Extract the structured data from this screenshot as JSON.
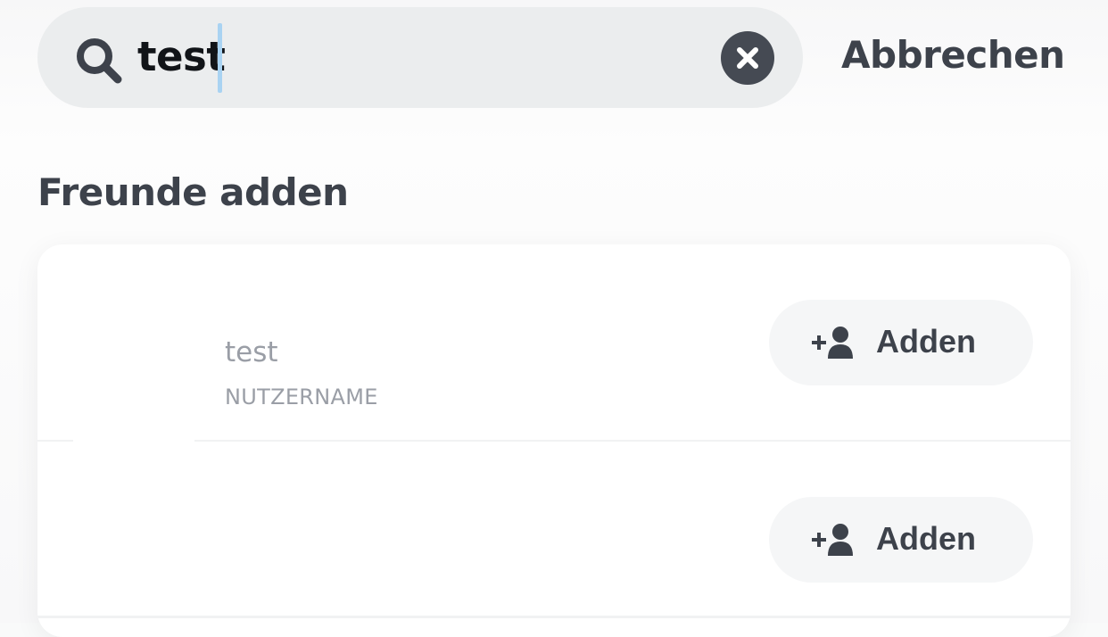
{
  "search": {
    "value": "test",
    "cancel_label": "Abbrechen"
  },
  "section": {
    "title": "Freunde adden"
  },
  "results": [
    {
      "name": "test",
      "subtitle": "NUTZERNAME",
      "add_label": "Adden"
    },
    {
      "name": "",
      "subtitle": "",
      "add_label": "Adden"
    }
  ],
  "icons": {
    "search": "search-icon",
    "clear": "close-circle-icon",
    "add_friend": "add-person-icon"
  },
  "colors": {
    "text_dark": "#3d424b",
    "text_muted": "#9a9ea6",
    "search_bg": "#ebedee",
    "caret": "#a9d3f2"
  }
}
